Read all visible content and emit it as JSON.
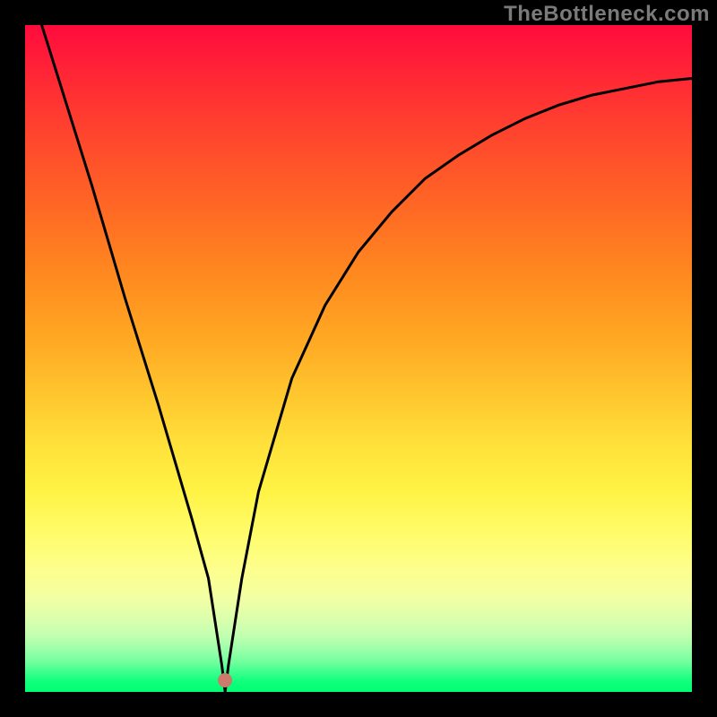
{
  "watermark": "TheBottleneck.com",
  "chart_data": {
    "type": "line",
    "title": "",
    "xlabel": "",
    "ylabel": "",
    "xlim": [
      0,
      1
    ],
    "ylim": [
      0,
      1
    ],
    "grid": false,
    "legend": false,
    "gradient": {
      "direction": "vertical",
      "stops": [
        {
          "pos": 0.0,
          "color": "#ff0b3d"
        },
        {
          "pos": 0.5,
          "color": "#ffc82f"
        },
        {
          "pos": 0.8,
          "color": "#fdff8f"
        },
        {
          "pos": 1.0,
          "color": "#00ff74"
        }
      ]
    },
    "series": [
      {
        "name": "bottleneck-curve",
        "x": [
          0.0,
          0.025,
          0.05,
          0.1,
          0.15,
          0.2,
          0.25,
          0.275,
          0.295,
          0.3,
          0.305,
          0.325,
          0.35,
          0.4,
          0.45,
          0.5,
          0.55,
          0.6,
          0.65,
          0.7,
          0.75,
          0.8,
          0.85,
          0.9,
          0.95,
          1.0
        ],
        "y": [
          1.08,
          1.0,
          0.92,
          0.76,
          0.59,
          0.43,
          0.26,
          0.17,
          0.04,
          0.0,
          0.04,
          0.17,
          0.3,
          0.47,
          0.58,
          0.66,
          0.72,
          0.77,
          0.805,
          0.835,
          0.86,
          0.88,
          0.895,
          0.905,
          0.915,
          0.92
        ]
      }
    ],
    "points": [
      {
        "name": "result-marker",
        "x": 0.3,
        "y": 0.017,
        "color": "#cc7a6b"
      }
    ],
    "annotations": []
  }
}
